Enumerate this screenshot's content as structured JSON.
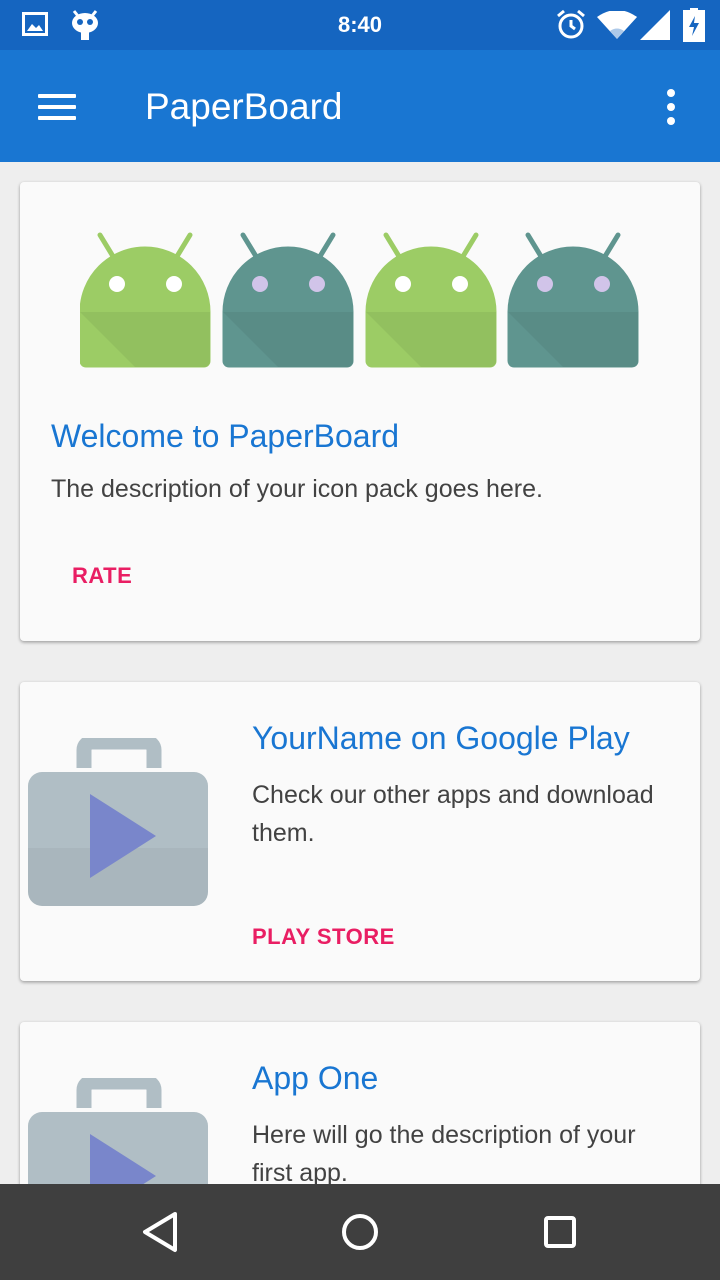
{
  "status_bar": {
    "time": "8:40",
    "left_icons": [
      "image-icon",
      "bug-icon"
    ],
    "right_icons": [
      "alarm-icon",
      "wifi-icon",
      "signal-icon",
      "battery-charging-icon"
    ]
  },
  "app_bar": {
    "title": "PaperBoard",
    "menu_icon": "hamburger-menu-icon",
    "overflow_icon": "more-vert-icon"
  },
  "cards": [
    {
      "title": "Welcome to PaperBoard",
      "description": "The description of your icon pack goes here.",
      "action": "RATE",
      "image": "android-robots"
    },
    {
      "title": "YourName on Google Play",
      "description": "Check our other apps and download them.",
      "action": "PLAY STORE",
      "image": "play-store-bag-icon"
    },
    {
      "title": "App One",
      "description": "Here will go the description of your first app.",
      "image": "play-store-bag-icon"
    }
  ],
  "nav_bar": {
    "back": "back-icon",
    "home": "home-icon",
    "recents": "recents-icon"
  },
  "colors": {
    "status_bar": "#1565c0",
    "app_bar": "#1976d2",
    "accent": "#e91e63",
    "title_text": "#1976d2",
    "android_green": "#9ccc65",
    "android_teal": "#5f958f"
  }
}
